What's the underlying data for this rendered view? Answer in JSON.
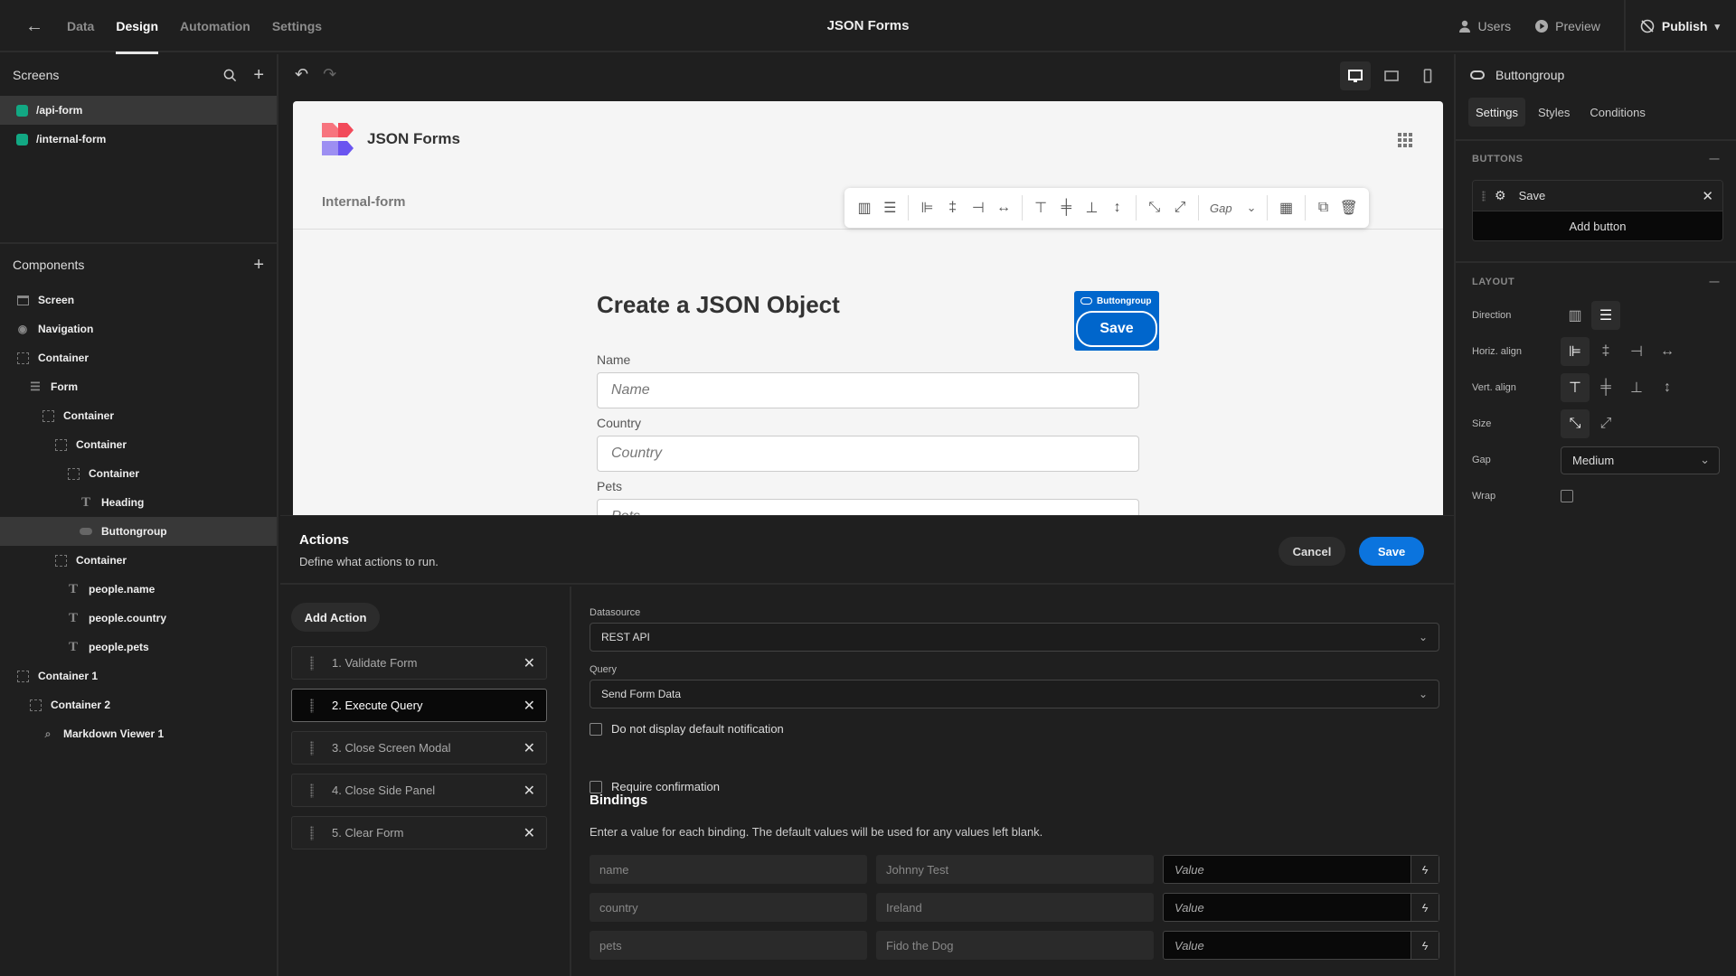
{
  "topbar": {
    "tabs": [
      {
        "label": "Data",
        "active": false
      },
      {
        "label": "Design",
        "active": true
      },
      {
        "label": "Automation",
        "active": false
      },
      {
        "label": "Settings",
        "active": false
      }
    ],
    "app_title": "JSON Forms",
    "users_label": "Users",
    "preview_label": "Preview",
    "publish_label": "Publish"
  },
  "screens": {
    "title": "Screens",
    "items": [
      {
        "label": "/api-form",
        "selected": true,
        "color": "#12a883"
      },
      {
        "label": "/internal-form",
        "selected": false,
        "color": "#12a883"
      }
    ]
  },
  "components": {
    "title": "Components",
    "items": [
      {
        "label": "Screen",
        "icon": "screen-icon",
        "depth": 0
      },
      {
        "label": "Navigation",
        "icon": "eye-icon",
        "depth": 0
      },
      {
        "label": "Container",
        "icon": "container-icon",
        "depth": 0
      },
      {
        "label": "Form",
        "icon": "form-icon",
        "depth": 1
      },
      {
        "label": "Container",
        "icon": "container-icon",
        "depth": 2
      },
      {
        "label": "Container",
        "icon": "container-icon",
        "depth": 3
      },
      {
        "label": "Container",
        "icon": "container-icon",
        "depth": 4
      },
      {
        "label": "Heading",
        "icon": "heading-icon",
        "depth": 5
      },
      {
        "label": "Buttongroup",
        "icon": "buttongroup-icon",
        "depth": 5,
        "selected": true
      },
      {
        "label": "Container",
        "icon": "container-icon",
        "depth": 3
      },
      {
        "label": "people.name",
        "icon": "text-icon",
        "depth": 4
      },
      {
        "label": "people.country",
        "icon": "text-icon",
        "depth": 4
      },
      {
        "label": "people.pets",
        "icon": "text-icon",
        "depth": 4
      },
      {
        "label": "Container 1",
        "icon": "container-icon",
        "depth": 0
      },
      {
        "label": "Container 2",
        "icon": "container-icon",
        "depth": 1
      },
      {
        "label": "Markdown Viewer 1",
        "icon": "markdown-icon",
        "depth": 2
      }
    ]
  },
  "preview": {
    "brand": "JSON Forms",
    "nav_link": "Internal-form",
    "heading": "Create a JSON Object",
    "toolbar_gap_label": "Gap",
    "buttongroup_label": "Buttongroup",
    "buttongroup_button": "Save",
    "fields": [
      {
        "label": "Name",
        "placeholder": "Name"
      },
      {
        "label": "Country",
        "placeholder": "Country"
      },
      {
        "label": "Pets",
        "placeholder": "Pets"
      }
    ]
  },
  "actions": {
    "title": "Actions",
    "subtitle": "Define what actions to run.",
    "cancel_label": "Cancel",
    "save_label": "Save",
    "add_action_label": "Add Action",
    "list": [
      {
        "label": "1. Validate Form",
        "selected": false
      },
      {
        "label": "2. Execute Query",
        "selected": true
      },
      {
        "label": "3. Close Screen Modal",
        "selected": false
      },
      {
        "label": "4. Close Side Panel",
        "selected": false
      },
      {
        "label": "5. Clear Form",
        "selected": false
      }
    ],
    "config": {
      "datasource_label": "Datasource",
      "datasource_value": "REST API",
      "query_label": "Query",
      "query_value": "Send Form Data",
      "no_notification_label": "Do not display default notification",
      "no_notification_checked": false,
      "require_confirmation_label": "Require confirmation",
      "require_confirmation_checked": false,
      "bindings_title": "Bindings",
      "bindings_desc": "Enter a value for each binding. The default values will be used for any values left blank.",
      "bindings": [
        {
          "key": "name",
          "default": "Johnny Test",
          "placeholder": "Value"
        },
        {
          "key": "country",
          "default": "Ireland",
          "placeholder": "Value"
        },
        {
          "key": "pets",
          "default": "Fido the Dog",
          "placeholder": "Value"
        }
      ]
    }
  },
  "inspector": {
    "component_name": "Buttongroup",
    "tabs": [
      {
        "label": "Settings",
        "active": true
      },
      {
        "label": "Styles",
        "active": false
      },
      {
        "label": "Conditions",
        "active": false
      }
    ],
    "buttons_section": "BUTTONS",
    "buttons": [
      {
        "label": "Save"
      }
    ],
    "add_button_label": "Add button",
    "layout_section": "LAYOUT",
    "direction_label": "Direction",
    "horiz_align_label": "Horiz. align",
    "vert_align_label": "Vert. align",
    "size_label": "Size",
    "gap_label": "Gap",
    "gap_value": "Medium",
    "wrap_label": "Wrap",
    "wrap_checked": false
  },
  "colors": {
    "accent": "#0b74de",
    "buttongroup_blue": "#0066cc",
    "screen_dot": "#12a883"
  }
}
